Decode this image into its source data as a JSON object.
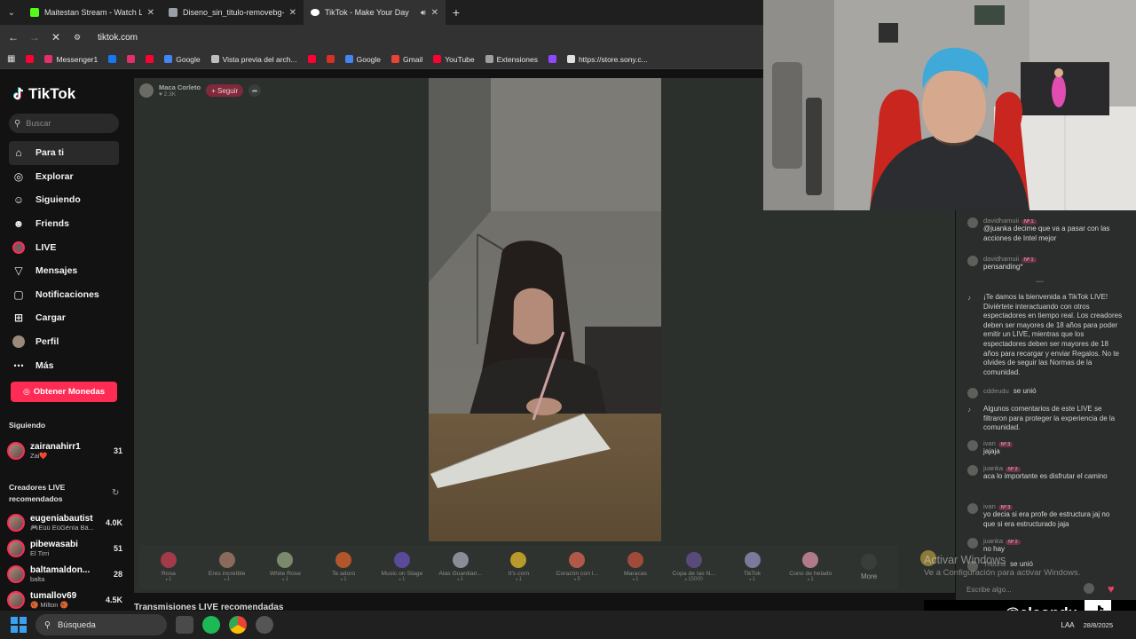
{
  "browser": {
    "tabs": [
      {
        "title": "Maitestan Stream - Watch Live",
        "color": "#53fc18"
      },
      {
        "title": "Diseno_sin_titulo-removebg-pr",
        "color": "#9aa0a6"
      },
      {
        "title": "TikTok - Make Your Day",
        "color": "#ffffff"
      }
    ],
    "url": "tiktok.com",
    "bookmarks": [
      {
        "label": "",
        "color": "#ff0033"
      },
      {
        "label": "Messenger1",
        "color": "#e1306c"
      },
      {
        "label": "",
        "color": "#1877f2"
      },
      {
        "label": "",
        "color": "#e1306c"
      },
      {
        "label": "",
        "color": "#ff0033"
      },
      {
        "label": "Google",
        "color": "#4285f4"
      },
      {
        "label": "Vista previa del arch...",
        "color": "#bdbdbd"
      },
      {
        "label": "",
        "color": "#ff0033"
      },
      {
        "label": "",
        "color": "#d93025"
      },
      {
        "label": "Google",
        "color": "#4285f4"
      },
      {
        "label": "Gmail",
        "color": "#ea4335"
      },
      {
        "label": "YouTube",
        "color": "#ff0033"
      },
      {
        "label": "Extensiones",
        "color": "#9e9e9e"
      },
      {
        "label": "",
        "color": "#9146ff"
      },
      {
        "label": "https://store.sony.c...",
        "color": "#e0e0e0"
      }
    ]
  },
  "tiktok": {
    "logo": "TikTok",
    "search_placeholder": "Buscar",
    "nav": [
      {
        "label": "Para ti",
        "icon": "home-icon",
        "glyph": "⌂"
      },
      {
        "label": "Explorar",
        "icon": "compass-icon",
        "glyph": "◎"
      },
      {
        "label": "Siguiendo",
        "icon": "following-icon",
        "glyph": "☺"
      },
      {
        "label": "Friends",
        "icon": "friends-icon",
        "glyph": "☻"
      },
      {
        "label": "LIVE",
        "icon": "live-icon",
        "glyph": "●"
      },
      {
        "label": "Mensajes",
        "icon": "send-icon",
        "glyph": "▽"
      },
      {
        "label": "Notificaciones",
        "icon": "inbox-icon",
        "glyph": "▢"
      },
      {
        "label": "Cargar",
        "icon": "upload-icon",
        "glyph": "⊞"
      },
      {
        "label": "Perfil",
        "icon": "profile-icon",
        "glyph": "●"
      },
      {
        "label": "Más",
        "icon": "more-icon",
        "glyph": "⋯"
      }
    ],
    "coins_button": "Obtener Monedas",
    "following_title": "Siguiendo",
    "following": [
      {
        "name": "zairanahirr1",
        "sub": "Zai❤️",
        "count": "31"
      }
    ],
    "recommended_title_1": "Creadores LIVE",
    "recommended_title_2": "recomendados",
    "recommended": [
      {
        "name": "eugeniabautist",
        "sub": "🎮Eüü EüGënïa Bä...",
        "count": "4.0K"
      },
      {
        "name": "pibewasabi",
        "sub": "El Tirri",
        "count": "51"
      },
      {
        "name": "baltamaldon...",
        "sub": "balta",
        "count": "28"
      },
      {
        "name": "tumallov69",
        "sub": "🏀 Milton 🏀",
        "count": "4.5K"
      }
    ],
    "recommended_streams_title": "Transmisiones LIVE recomendadas"
  },
  "live": {
    "streamer_name": "Maca Corleto",
    "viewers": "2.3K",
    "follow_label": "+ Seguir",
    "gifts": [
      {
        "name": "Rosa",
        "price": "1",
        "color": "#a23a4a"
      },
      {
        "name": "Eres increíble",
        "price": "1",
        "color": "#8a6a5a"
      },
      {
        "name": "White Rose",
        "price": "1",
        "color": "#7a8a6a"
      },
      {
        "name": "Te adoro",
        "price": "1",
        "color": "#b2552a"
      },
      {
        "name": "Music on Stage",
        "price": "1",
        "color": "#5a4a9a"
      },
      {
        "name": "Alas Guardian...",
        "price": "1",
        "color": "#8a8c98"
      },
      {
        "name": "It's corn",
        "price": "1",
        "color": "#b89a2a"
      },
      {
        "name": "Corazón con l...",
        "price": "5",
        "color": "#b0584a"
      },
      {
        "name": "Maracas",
        "price": "1",
        "color": "#a04a3a"
      },
      {
        "name": "Copa de las N...",
        "price": "15000",
        "color": "#5a4a7a"
      },
      {
        "name": "TikTok",
        "price": "1",
        "color": "#7a7a9a"
      },
      {
        "name": "Cono de helado",
        "price": "1",
        "color": "#b07a8a"
      }
    ],
    "more_label": "More"
  },
  "chat": {
    "messages": [
      {
        "user": "davidhamuii",
        "badge": "Nº 1",
        "text": "@juanka decime que va a pasar con las acciones de Intel mejor"
      },
      {
        "user": "davidhamuii",
        "badge": "Nº 1",
        "text": "pensanding*"
      },
      {
        "system": "¡Te damos la bienvenida a TikTok LIVE! Diviértete interactuando con otros espectadores en tiempo real. Los creadores deben ser mayores de 18 años para poder emitir un LIVE, mientras que los espectadores deben ser mayores de 18 años para recargar y enviar Regalos. No te olvides de seguir las Normas de la comunidad."
      },
      {
        "user": "cddeudu",
        "text": "se unió"
      },
      {
        "system": "Algunos comentarios de este LIVE se filtraron para proteger la experiencia de la comunidad."
      },
      {
        "user": "ivan",
        "badge": "Nº 3",
        "text": "jajaja"
      },
      {
        "user": "juanka",
        "badge": "Nº 2",
        "text": "aca lo importante es disfrutar el camino"
      },
      {
        "user": "ivan",
        "badge": "Nº 3",
        "text": "yo decia si era profe de estructura jaj no que si era estructurado jaja"
      },
      {
        "user": "juanka",
        "badge": "Nº 2",
        "text": "no hay"
      },
      {
        "user": "Tribuna",
        "text": "se unió"
      }
    ],
    "input_placeholder": "Escribe algo..."
  },
  "overlay": {
    "windows_watermark_1": "Activar Windows",
    "windows_watermark_2": "Ve a Configuración para activar Windows.",
    "handle": "@elcondu"
  },
  "taskbar": {
    "search_label": "Búsqueda",
    "lang": "LAA",
    "date": "28/8/2025"
  }
}
